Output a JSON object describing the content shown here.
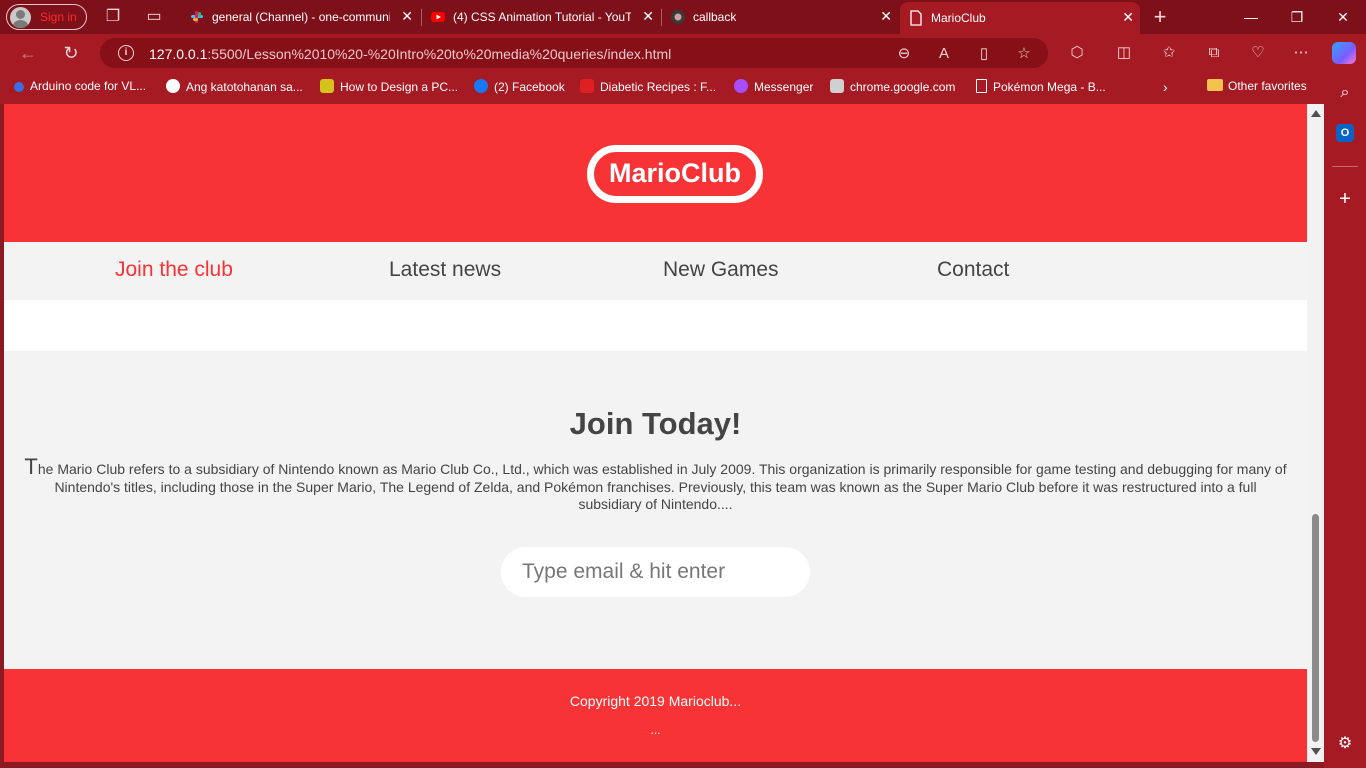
{
  "browser": {
    "profile_label": "Sign in",
    "tabs": [
      {
        "title": "general (Channel) - one-communi",
        "icon": "slack-icon",
        "active": false
      },
      {
        "title": "(4) CSS Animation Tutorial - YouTu",
        "icon": "youtube-icon",
        "active": false
      },
      {
        "title": "callback",
        "icon": "github-icon",
        "active": false
      },
      {
        "title": "MarioClub",
        "icon": "document-icon",
        "active": true
      }
    ],
    "address": {
      "host": "127.0.0.1",
      "path": ":5500/Lesson%2010%20-%20Intro%20to%20media%20queries/index.html"
    },
    "favorites": [
      {
        "label": "Arduino code for VL...",
        "icon": "search-icon",
        "color": "#3b6fe0"
      },
      {
        "label": "Ang katotohanan sa...",
        "icon": "wordpress-icon",
        "color": "#ffffff"
      },
      {
        "label": "How to Design a PC...",
        "icon": "pcb-icon",
        "color": "#d4c31a"
      },
      {
        "label": "(2) Facebook",
        "icon": "facebook-icon",
        "color": "#1877f2"
      },
      {
        "label": "Diabetic Recipes : F...",
        "icon": "food-icon",
        "color": "#e02020"
      },
      {
        "label": "Messenger",
        "icon": "messenger-icon",
        "color": "#a64dff"
      },
      {
        "label": "chrome.google.com",
        "icon": "image-icon",
        "color": "#d0d0d0"
      },
      {
        "label": "Pokémon Mega - B...",
        "icon": "document-icon",
        "color": "#ffffff"
      }
    ],
    "other_favorites": "Other favorites"
  },
  "page": {
    "logo": "MarioClub",
    "nav": [
      "Join the club",
      "Latest news",
      "New Games",
      "Contact"
    ],
    "join_title": "Join Today!",
    "join_dropcap": "T",
    "join_text": "he Mario Club refers to a subsidiary of Nintendo known as Mario Club Co., Ltd., which was established in July 2009. This organization is primarily responsible for game testing and debugging for many of Nintendo's titles, including those in the Super Mario, The Legend of Zelda, and Pokémon franchises. Previously, this team was known as the Super Mario Club before it was restructured into a full subsidiary of Nintendo....",
    "email_placeholder": "Type email & hit enter",
    "footer_copyright": "Copyright 2019 Marioclub...",
    "footer_more": "...",
    "colors": {
      "brand_red": "#f73335",
      "light_gray": "#f3f3f3",
      "text": "#444444"
    }
  }
}
